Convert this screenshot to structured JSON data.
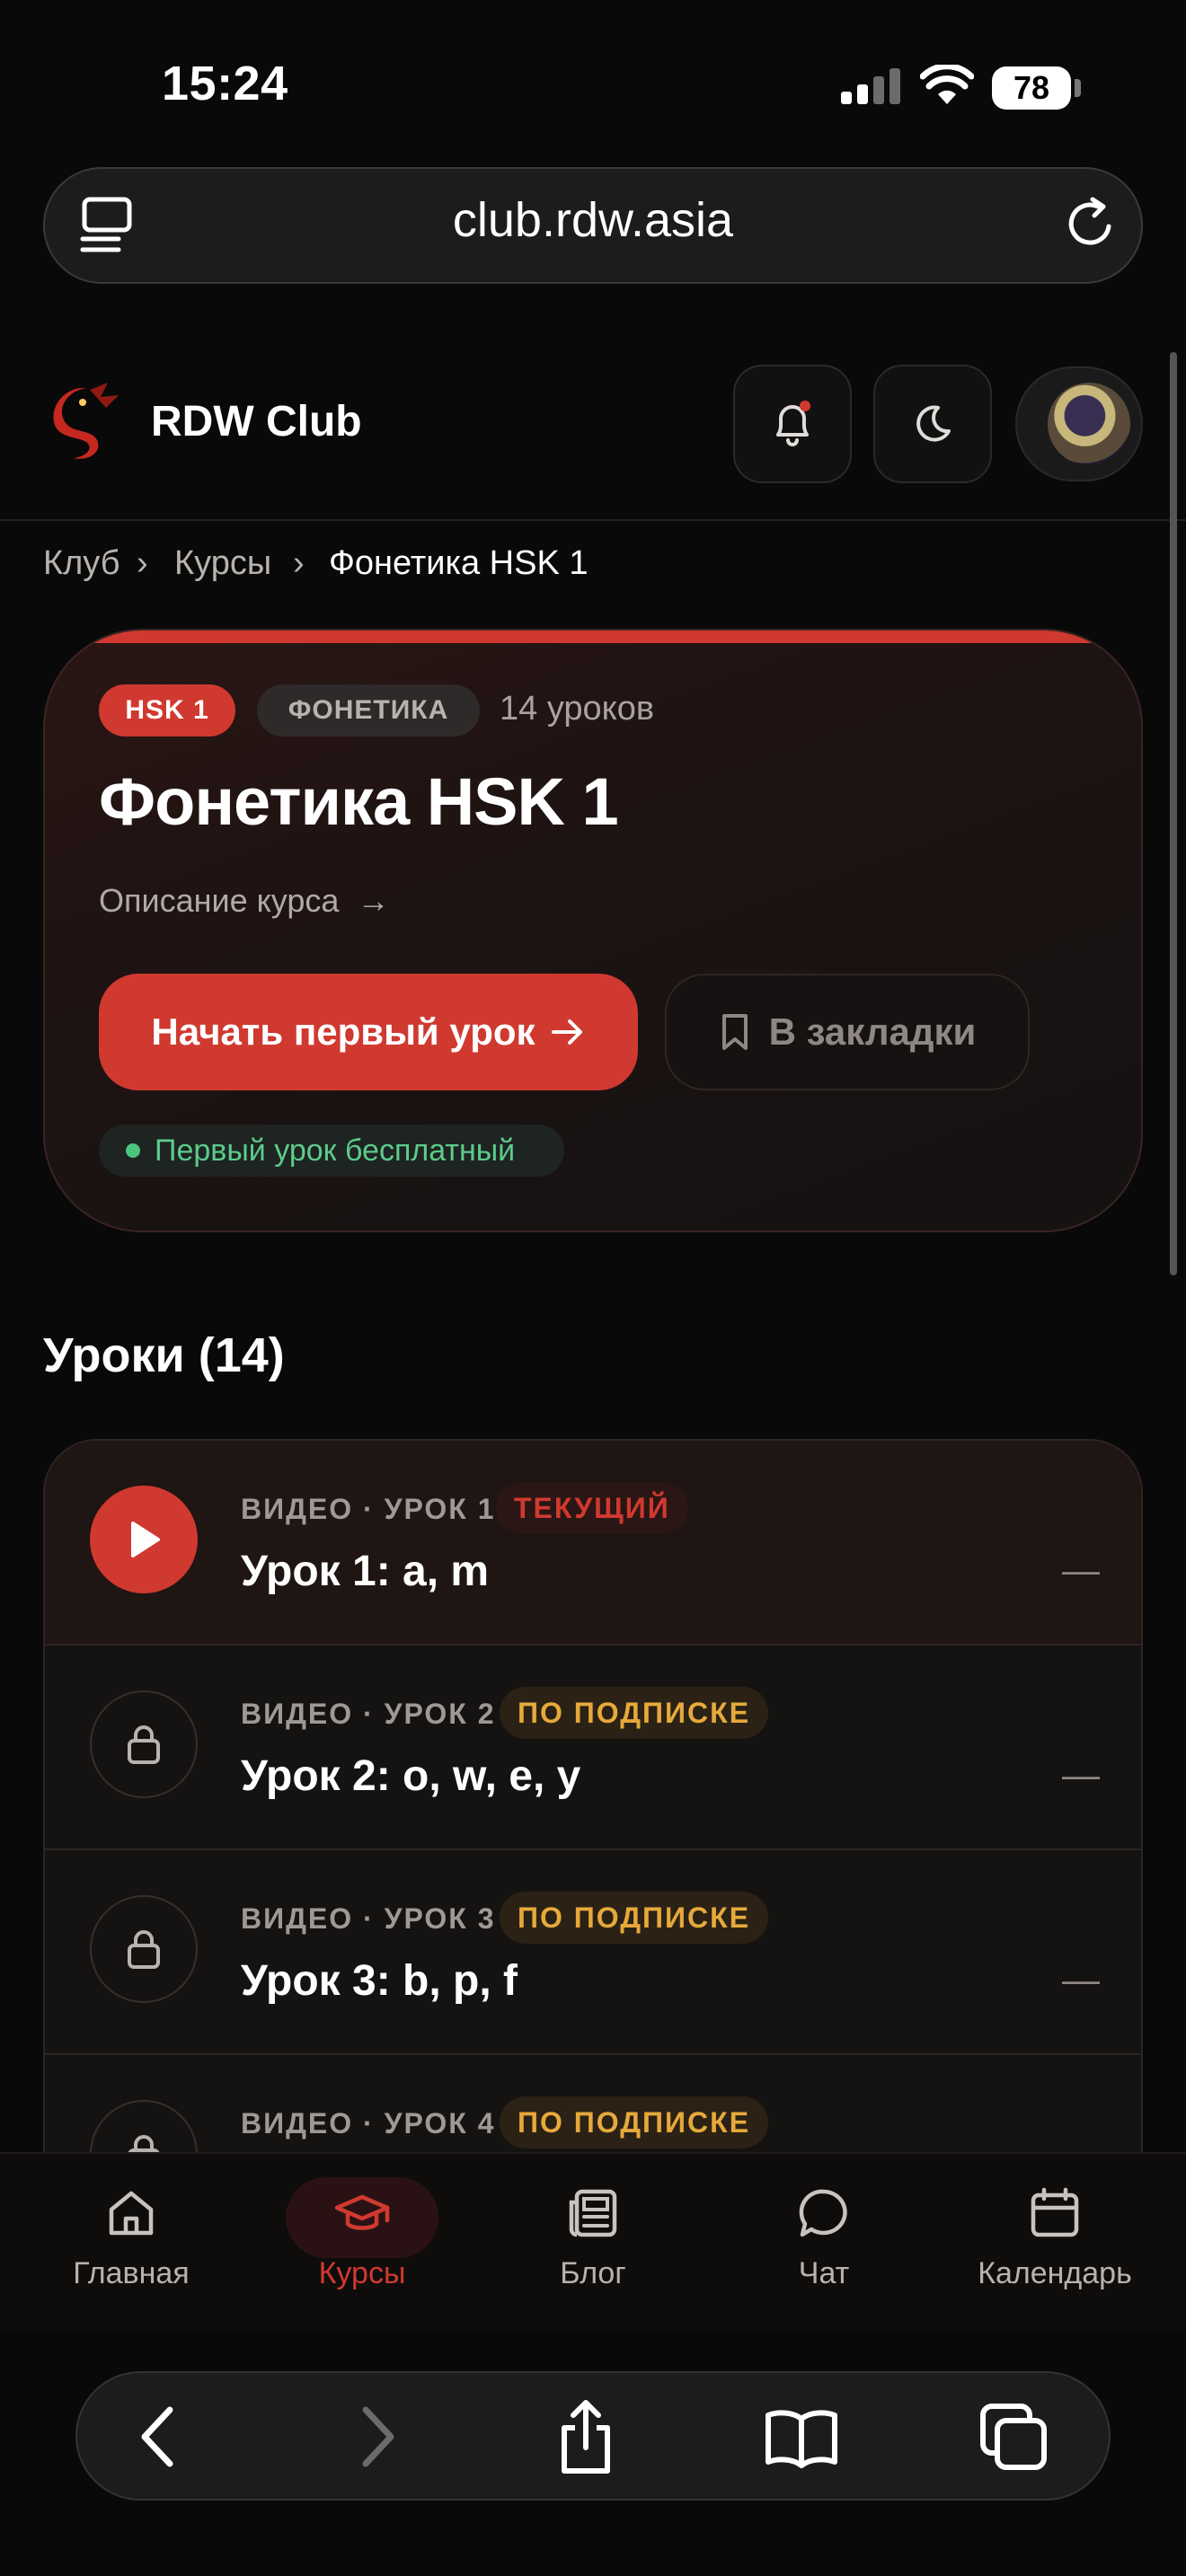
{
  "status_bar": {
    "time": "15:24",
    "battery": "78"
  },
  "browser": {
    "url": "club.rdw.asia"
  },
  "header": {
    "brand": "RDW Club"
  },
  "breadcrumb": {
    "items": [
      "Клуб",
      "Курсы",
      "Фонетика HSK 1"
    ]
  },
  "course": {
    "tags": [
      "HSK 1",
      "ФОНЕТИКА"
    ],
    "lessons_count": "14 уроков",
    "title": "Фонетика HSK 1",
    "description_link": "Описание курса",
    "start_button": "Начать первый урок",
    "bookmark_button": "В закладки",
    "free_note": "Первый урок бесплатный"
  },
  "lessons": {
    "section_title": "Уроки (14)",
    "items": [
      {
        "meta": "ВИДЕО · УРОК 1",
        "badge": "ТЕКУЩИЙ",
        "title": "Урок 1: a, m",
        "duration": "—"
      },
      {
        "meta": "ВИДЕО · УРОК 2",
        "badge": "ПО ПОДПИСКЕ",
        "title": "Урок 2: o, w, e, y",
        "duration": "—"
      },
      {
        "meta": "ВИДЕО · УРОК 3",
        "badge": "ПО ПОДПИСКЕ",
        "title": "Урок 3: b, p, f",
        "duration": "—"
      },
      {
        "meta": "ВИДЕО · УРОК 4",
        "badge": "ПО ПОДПИСКЕ",
        "title": "",
        "duration": ""
      }
    ]
  },
  "bottom_nav": {
    "items": [
      {
        "label": "Главная",
        "icon": "home-icon"
      },
      {
        "label": "Курсы",
        "icon": "graduation-cap-icon"
      },
      {
        "label": "Блог",
        "icon": "newspaper-icon"
      },
      {
        "label": "Чат",
        "icon": "chat-bubble-icon"
      },
      {
        "label": "Календарь",
        "icon": "calendar-icon"
      }
    ],
    "active_index": 1
  },
  "colors": {
    "accent": "#d0392f",
    "success": "#4cc37f",
    "warning": "#e6a93b",
    "background": "#0a0909"
  }
}
